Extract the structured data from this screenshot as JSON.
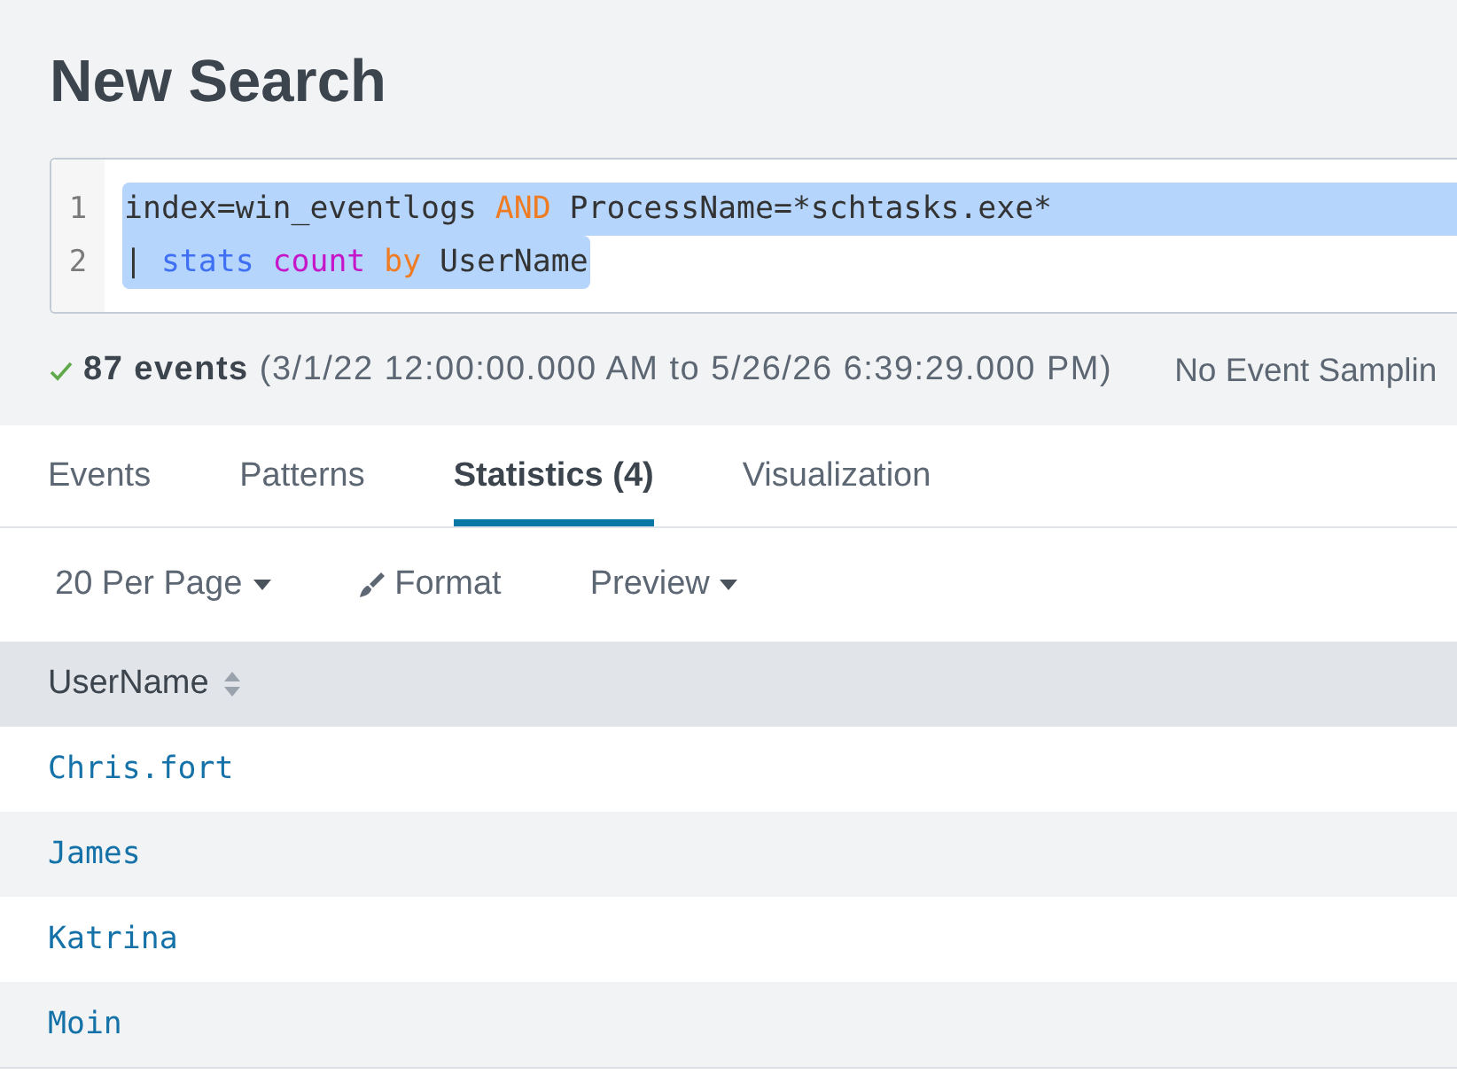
{
  "page": {
    "title": "New Search"
  },
  "search": {
    "lines": [
      {
        "number": "1",
        "selected": true,
        "tokens": [
          {
            "text": "index=win_eventlogs ",
            "kind": "plain"
          },
          {
            "text": "AND",
            "kind": "operator"
          },
          {
            "text": " ProcessName=*schtasks.exe*",
            "kind": "plain"
          }
        ]
      },
      {
        "number": "2",
        "selected": true,
        "tokens": [
          {
            "text": "| ",
            "kind": "plain"
          },
          {
            "text": "stats",
            "kind": "command"
          },
          {
            "text": " count",
            "kind": "function"
          },
          {
            "text": " by",
            "kind": "operator"
          },
          {
            "text": " UserName",
            "kind": "plain"
          }
        ]
      }
    ]
  },
  "status": {
    "summary": "**87 events** (3/1/22 12:00:00.000 AM to 5/26/26 6:39:29.000 PM)",
    "sampling": "No Event Samplin"
  },
  "tabs": [
    {
      "label": "Events",
      "selected": false
    },
    {
      "label": "Patterns",
      "selected": false
    },
    {
      "label": "Statistics (4)",
      "selected": true
    },
    {
      "label": "Visualization",
      "selected": false
    }
  ],
  "toolbar": [
    {
      "label": "20 Per Page",
      "kind": "menu"
    },
    {
      "label": "Format",
      "kind": "format"
    },
    {
      "label": "Preview",
      "kind": "menu"
    }
  ],
  "table": {
    "columns": [
      {
        "label": "UserName",
        "sortable": true
      }
    ],
    "rows": [
      [
        "Chris.fort"
      ],
      [
        "James"
      ],
      [
        "Katrina"
      ],
      [
        "Moin"
      ]
    ]
  }
}
